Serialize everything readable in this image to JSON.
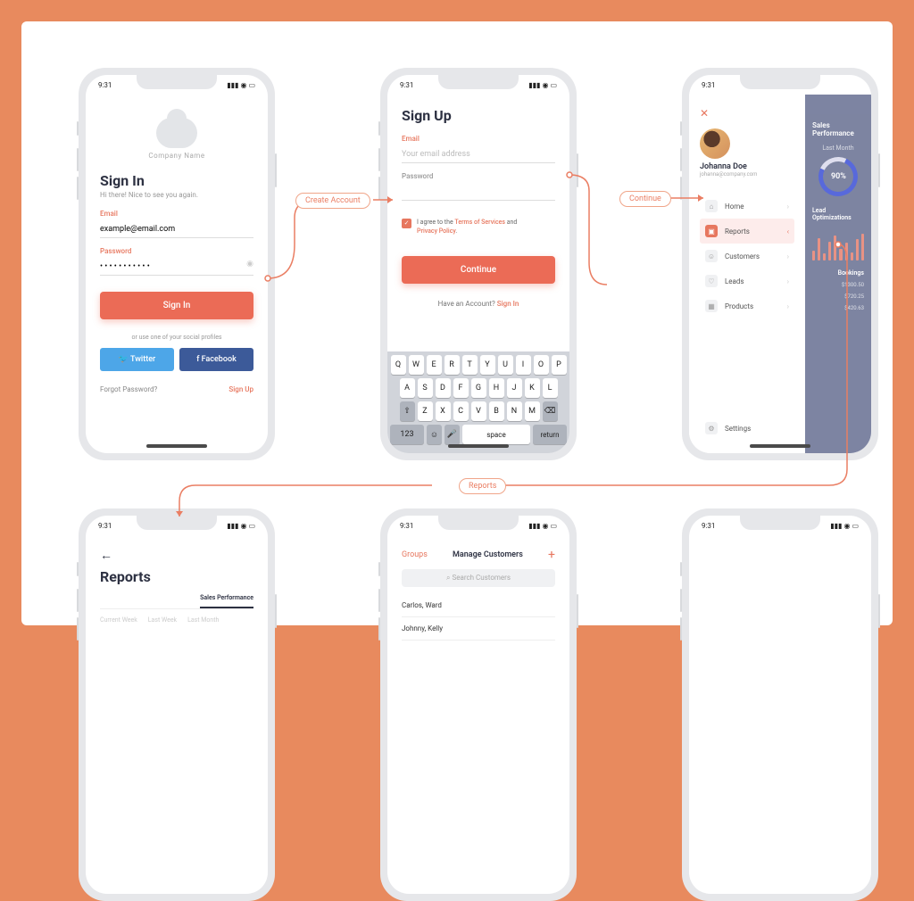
{
  "status_time": "9:31",
  "signin": {
    "company": "Company Name",
    "title": "Sign In",
    "subtitle": "Hi there! Nice to see you again.",
    "email_label": "Email",
    "email_value": "example@email.com",
    "password_label": "Password",
    "password_dots": "• • • • • • • • • • •",
    "button": "Sign In",
    "or_text": "or use one of your social profiles",
    "twitter": "Twitter",
    "facebook": "Facebook",
    "forgot": "Forgot Password?",
    "signup": "Sign Up"
  },
  "signup": {
    "title": "Sign Up",
    "email_label": "Email",
    "email_placeholder": "Your email address",
    "password_label": "Password",
    "terms_pre": "I agree to the ",
    "terms": "Terms of Services",
    "terms_and": " and ",
    "privacy": "Privacy Policy",
    "button": "Continue",
    "have_pre": "Have an Account? ",
    "have_link": "Sign In"
  },
  "keyboard": {
    "space": "space",
    "return": "return",
    "num": "123"
  },
  "drawer": {
    "user_name": "Johanna Doe",
    "user_email": "johanna@company.com",
    "items": {
      "home": "Home",
      "reports": "Reports",
      "customers": "Customers",
      "leads": "Leads",
      "products": "Products",
      "settings": "Settings"
    },
    "bd_title": "Sales Performance",
    "bd_last": "Last Month",
    "bd_pct": "90%",
    "bd_opt": "Lead Optimizations",
    "bd_book": "Bookings",
    "bd_vals": {
      "a": "$1300.50",
      "b": "$720.25",
      "c": "$420.63"
    }
  },
  "reports": {
    "title": "Reports",
    "tab_active": "Sales Performance",
    "t1": "Current Week",
    "t2": "Last Week",
    "t3": "Last Month"
  },
  "customers": {
    "groups": "Groups",
    "title": "Manage Customers",
    "search": "Search Customers",
    "row1": "Carlos, Ward",
    "row2": "Johnny, Kelly"
  },
  "connectors": {
    "create": "Create Account",
    "continue": "Continue",
    "reports": "Reports"
  },
  "chart_data": {
    "type": "bar",
    "title": "Lead Optimizations",
    "values": [
      12,
      26,
      9,
      22,
      30,
      14,
      21,
      10,
      25,
      32
    ]
  },
  "colors": {
    "accent": "#eb6b56",
    "frame": "#e88a5e"
  }
}
